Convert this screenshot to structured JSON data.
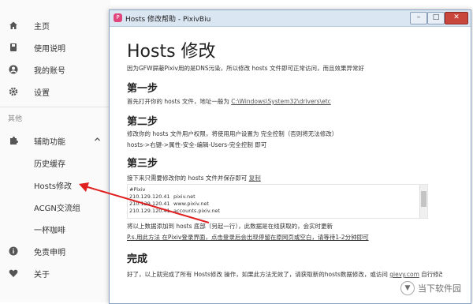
{
  "sidebar": {
    "items": [
      {
        "icon": "home-icon",
        "label": "主页"
      },
      {
        "icon": "book-icon",
        "label": "使用说明"
      },
      {
        "icon": "account-icon",
        "label": "我的账号"
      },
      {
        "icon": "gear-icon",
        "label": "设置"
      }
    ],
    "section_label": "其他",
    "tools": {
      "icon": "puzzle-icon",
      "label": "辅助功能"
    },
    "sub_items": [
      "历史缓存",
      "Hosts修改",
      "ACGN交流组",
      "一杯咖啡"
    ],
    "bottom_items": [
      {
        "icon": "info-icon",
        "label": "免责申明"
      },
      {
        "icon": "heart-icon",
        "label": "关于"
      }
    ]
  },
  "window": {
    "title": "Hosts 修改帮助 - PixivBiu",
    "heading": "Hosts 修改",
    "intro": "因为GFW屏蔽Pixiv用的是DNS污染，所以修改 hosts 文件即可正常访问，而且效果异常好",
    "step1_title": "第一步",
    "step1_text": "首先打开你的 hosts 文件，地址一般为 ",
    "step1_path": "C:\\Windows\\System32\\drivers\\etc",
    "step2_title": "第二步",
    "step2_text1": "修改你的 hosts 文件用户权限，将使用用户设置为 完全控制（否则将无法修改）",
    "step2_text2": "hosts->右键->属性-安全-编辑-Users-完全控制 即可",
    "step3_title": "第三步",
    "step3_text": "接下来只需要修改你的 hosts 文件并保存即可 ",
    "step3_copy": "复制",
    "hosts_lines": [
      {
        "ip": "#Pixiv",
        "host": ""
      },
      {
        "ip": "210.129.120.41",
        "host": "pixiv.net"
      },
      {
        "ip": "210.129.120.41",
        "host": "www.pixiv.net"
      },
      {
        "ip": "210.129.120.41",
        "host": "accounts.pixiv.net"
      }
    ],
    "note1": "将以上数据添加到 hosts 底部（另起一行），此数据是在线获取的，会实时更新",
    "note2": "P.s.用此方法 在Pixiv登录界面，点击登录后会出现停留在原网页或空白，请等待1-2分钟即可",
    "done_title": "完成",
    "done_text": "好了，以上就完成了所有 Hosts修改 操作，如果此方法无效了，请获取新的hosts数据修改，或访问 ",
    "done_link": "gievy.com",
    "done_tail": " 自行修改"
  },
  "watermark": "当下软件园",
  "colors": {
    "arrow": "#e02020",
    "accent": "#e0457b",
    "titlebar": "#dbe6f3"
  }
}
